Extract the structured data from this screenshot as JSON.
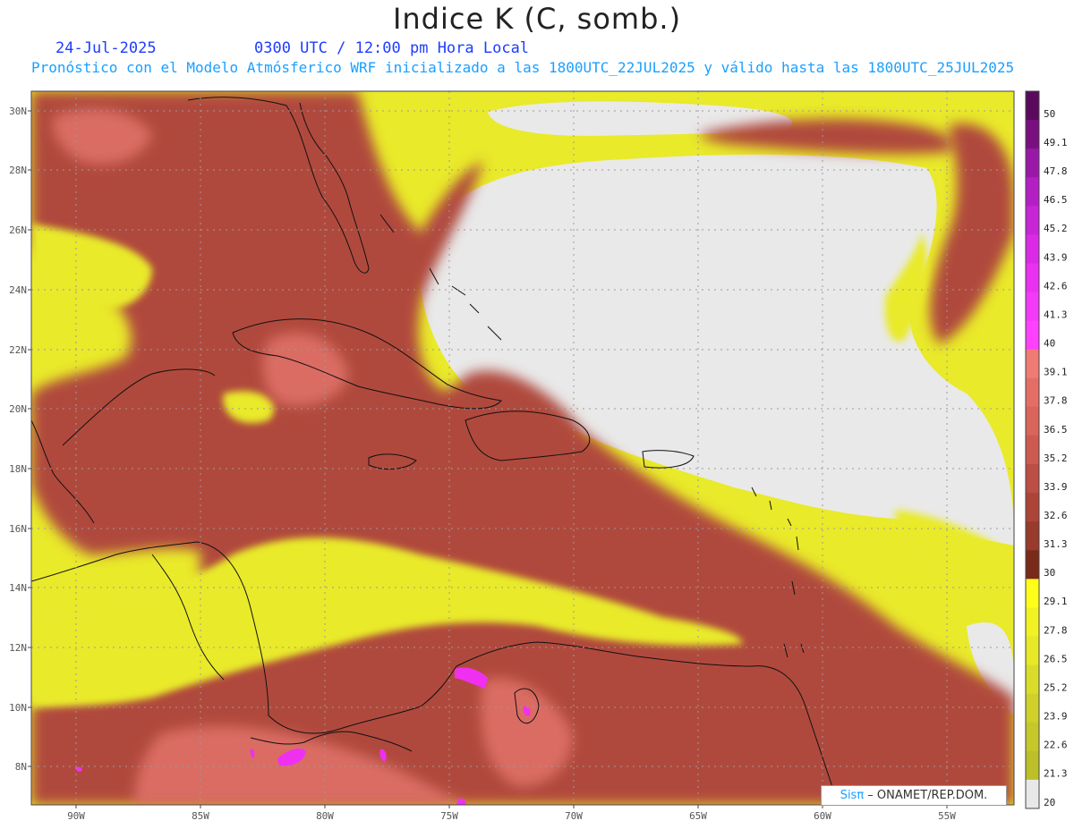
{
  "title": "Indice K (C, somb.)",
  "date": "24-Jul-2025",
  "time": "0300 UTC / 12:00 pm Hora Local",
  "subtitle": "Pronóstico con el Modelo Atmósferico WRF inicializado a las 1800UTC_22JUL2025 y válido hasta las  1800UTC_25JUL2025",
  "credit": {
    "brand": "Sisπ",
    "text": " – ONAMET/REP.DOM."
  },
  "map": {
    "lat_range": [
      7,
      31
    ],
    "lon_range": [
      -92.5,
      -52.0
    ],
    "lat_labels": [
      "30N",
      "28N",
      "26N",
      "24N",
      "22N",
      "20N",
      "18N",
      "16N",
      "14N",
      "12N",
      "10N",
      "8N"
    ],
    "lon_labels": [
      "90W",
      "85W",
      "80W",
      "75W",
      "70W",
      "65W",
      "60W",
      "55W"
    ],
    "gridlines": true,
    "background_color": "#e9e9e9"
  },
  "colorbar": {
    "labels": [
      "50",
      "49.1",
      "47.8",
      "46.5",
      "45.2",
      "43.9",
      "42.6",
      "41.3",
      "40",
      "39.1",
      "37.8",
      "36.5",
      "35.2",
      "33.9",
      "32.6",
      "31.3",
      "30",
      "29.1",
      "27.8",
      "26.5",
      "25.2",
      "23.9",
      "22.6",
      "21.3",
      "20"
    ],
    "colors": [
      "#5a0a5c",
      "#7a1080",
      "#9a18a8",
      "#b41fc4",
      "#c825d6",
      "#db2ae6",
      "#ea30f0",
      "#f23af8",
      "#ff40ff",
      "#f07a74",
      "#e46e66",
      "#d8645a",
      "#cc5a50",
      "#bc4e44",
      "#ac4438",
      "#983a2c",
      "#7a2a18",
      "#ffff1a",
      "#f2f222",
      "#e6e828",
      "#dadc2a",
      "#cfd12a",
      "#c6c82a",
      "#bcbf28",
      "#e8e8e8"
    ]
  }
}
